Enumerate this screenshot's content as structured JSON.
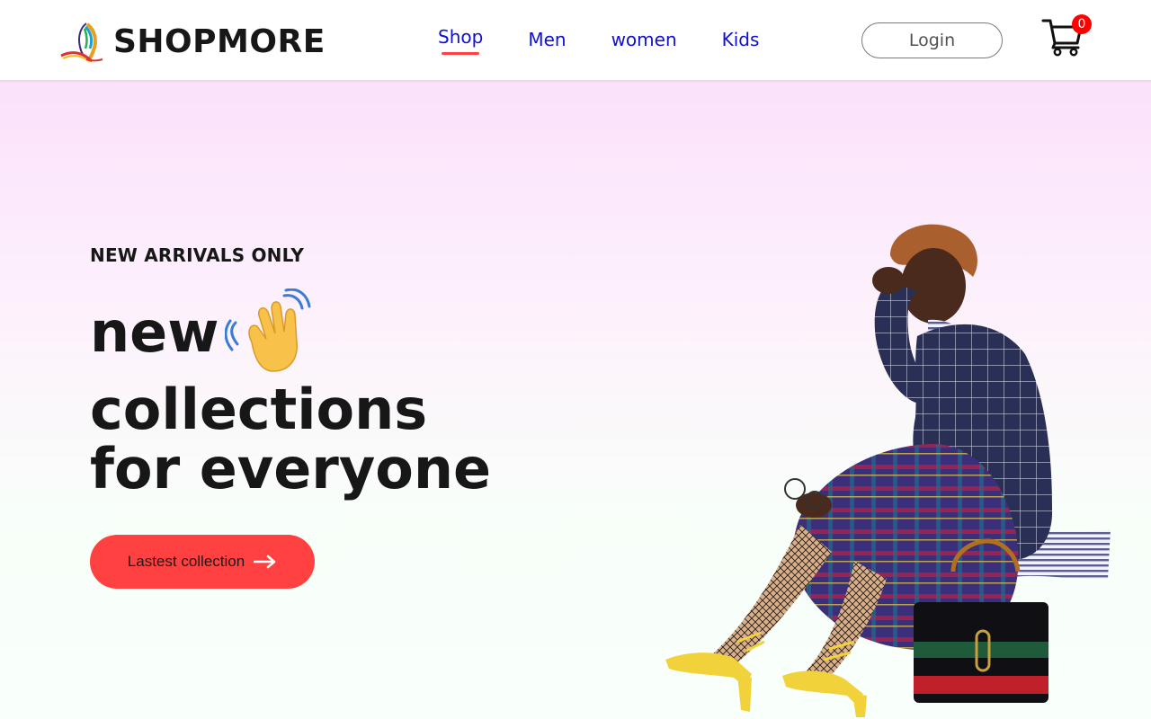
{
  "brand": {
    "name": "SHOPMORE",
    "logo_icon": "feather-logo-icon"
  },
  "nav": {
    "items": [
      {
        "label": "Shop",
        "active": true
      },
      {
        "label": "Men",
        "active": false
      },
      {
        "label": "women",
        "active": false
      },
      {
        "label": "Kids",
        "active": false
      }
    ],
    "link_color": "#1010d4",
    "active_underline_color": "#ff4141"
  },
  "login": {
    "label": "Login"
  },
  "cart": {
    "icon": "shopping-cart-icon",
    "count": "0",
    "badge_color": "#ff0000"
  },
  "hero": {
    "kicker": "NEW ARRIVALS ONLY",
    "line1": "new",
    "line2": "collections",
    "line3": "for everyone",
    "wave_icon": "waving-hand-icon",
    "cta": {
      "label": "Lastest collection",
      "icon": "arrow-right-icon",
      "color": "#ff4141"
    },
    "image": "fashion-model-image",
    "gradient_top": "#fbe1fb",
    "gradient_bottom": "#f9fffb"
  }
}
